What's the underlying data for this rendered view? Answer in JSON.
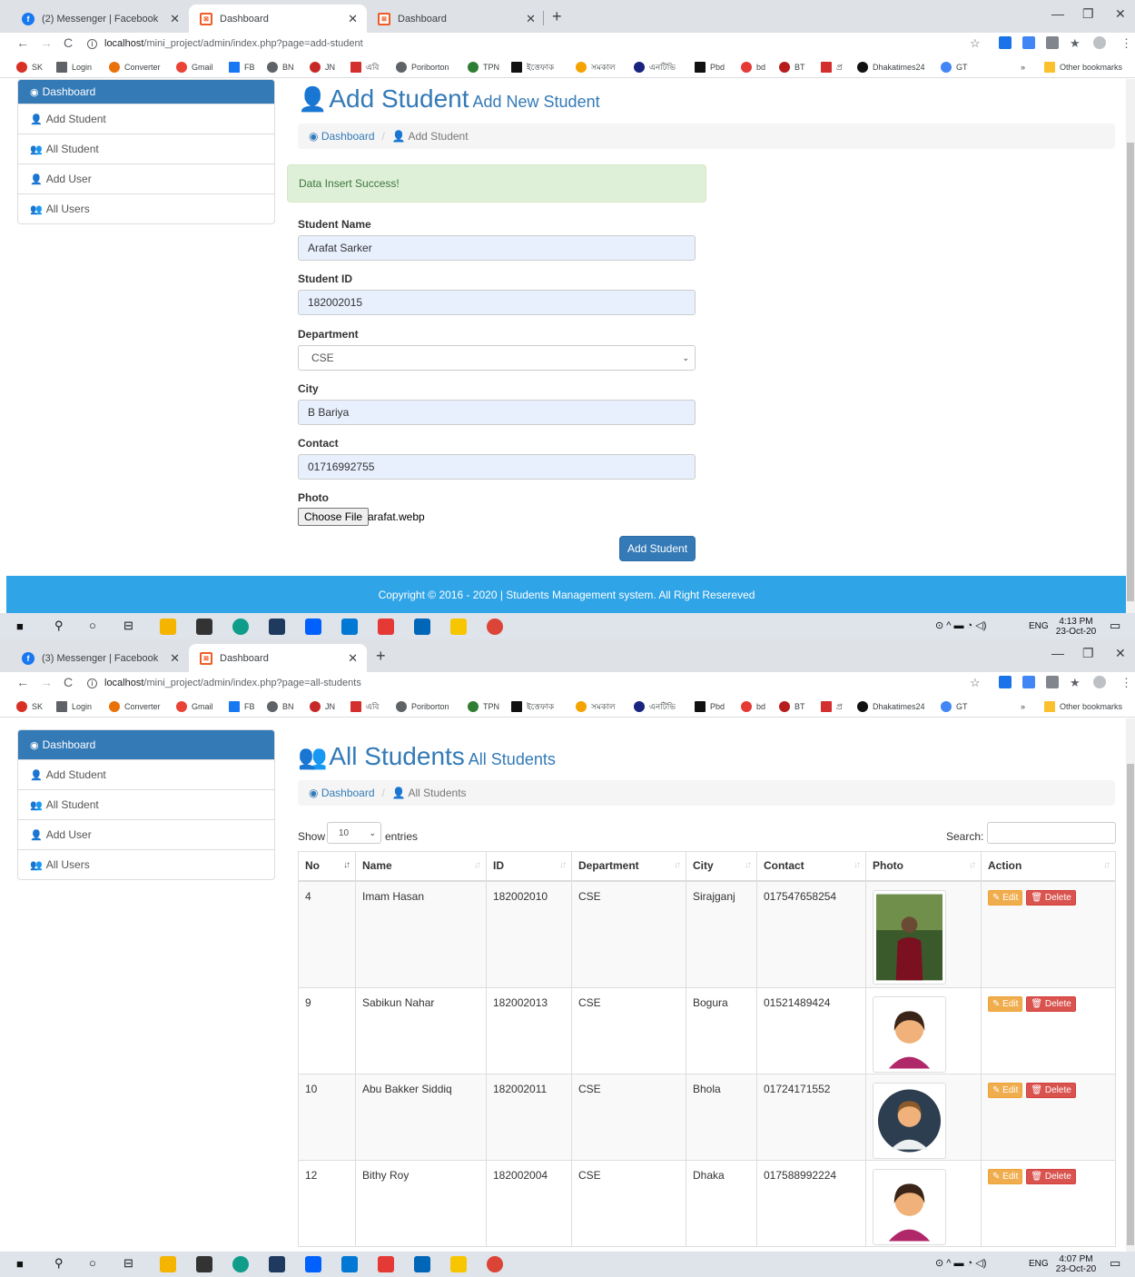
{
  "browser_a": {
    "tabs": [
      {
        "title": "(2) Messenger | Facebook"
      },
      {
        "title": "Dashboard"
      },
      {
        "title": "Dashboard"
      }
    ],
    "url_host": "localhost",
    "url_path": "/mini_project/admin/index.php?page=add-student"
  },
  "browser_b": {
    "tabs": [
      {
        "title": "(3) Messenger | Facebook"
      },
      {
        "title": "Dashboard"
      }
    ],
    "url_host": "localhost",
    "url_path": "/mini_project/admin/index.php?page=all-students"
  },
  "bookmarks": [
    "SK",
    "Login",
    "Converter",
    "Gmail",
    "FB",
    "BN",
    "JN",
    "এবি",
    "Poriborton",
    "TPN",
    "ইত্তেফাক",
    "সমকাল",
    "এনটিভি",
    "Pbd",
    "bd",
    "BT",
    "প্র",
    "Dhakatimes24",
    "GT"
  ],
  "bookmarks_more": "»",
  "other_bookmarks": "Other bookmarks",
  "sidebar": {
    "items": [
      {
        "label": "Dashboard"
      },
      {
        "label": "Add Student"
      },
      {
        "label": "All Student"
      },
      {
        "label": "Add User"
      },
      {
        "label": "All Users"
      }
    ]
  },
  "add_page": {
    "title": "Add Student",
    "subtitle": "Add New Student",
    "breadcrumb_home": "Dashboard",
    "breadcrumb_current": "Add Student",
    "alert": "Data Insert Success!",
    "fields": {
      "name_label": "Student Name",
      "name_value": "Arafat Sarker",
      "id_label": "Student ID",
      "id_value": "182002015",
      "dept_label": "Department",
      "dept_value": "CSE",
      "city_label": "City",
      "city_value": "B Bariya",
      "contact_label": "Contact",
      "contact_value": "01716992755",
      "photo_label": "Photo",
      "file_button": "Choose File",
      "file_name": "arafat.webp"
    },
    "submit": "Add Student",
    "footer": "Copyright © 2016 - 2020 | Students Management system. All Right Resereved"
  },
  "list_page": {
    "title": "All Students",
    "subtitle": "All Students",
    "breadcrumb_home": "Dashboard",
    "breadcrumb_current": "All Students",
    "show_label": "Show",
    "entries_value": "10",
    "entries_label": "entries",
    "search_label": "Search:",
    "columns": [
      "No",
      "Name",
      "ID",
      "Department",
      "City",
      "Contact",
      "Photo",
      "Action"
    ],
    "rows": [
      {
        "no": "4",
        "name": "Imam Hasan",
        "id": "182002010",
        "dept": "CSE",
        "city": "Sirajganj",
        "contact": "017547658254"
      },
      {
        "no": "9",
        "name": "Sabikun Nahar",
        "id": "182002013",
        "dept": "CSE",
        "city": "Bogura",
        "contact": "01521489424"
      },
      {
        "no": "10",
        "name": "Abu Bakker Siddiq",
        "id": "182002011",
        "dept": "CSE",
        "city": "Bhola",
        "contact": "01724171552"
      },
      {
        "no": "12",
        "name": "Bithy Roy",
        "id": "182002004",
        "dept": "CSE",
        "city": "Dhaka",
        "contact": "017588992224"
      }
    ],
    "edit_label": "Edit",
    "delete_label": "Delete"
  },
  "taskbar_a": {
    "time": "4:13 PM",
    "date": "23-Oct-20",
    "lang": "ENG"
  },
  "taskbar_b": {
    "time": "4:07 PM",
    "date": "23-Oct-20",
    "lang": "ENG"
  },
  "colors": {
    "primary": "#337ab7",
    "footer": "#2fa4e7",
    "success_bg": "#dff0d8",
    "edit": "#f0ad4e",
    "delete": "#d9534f"
  }
}
